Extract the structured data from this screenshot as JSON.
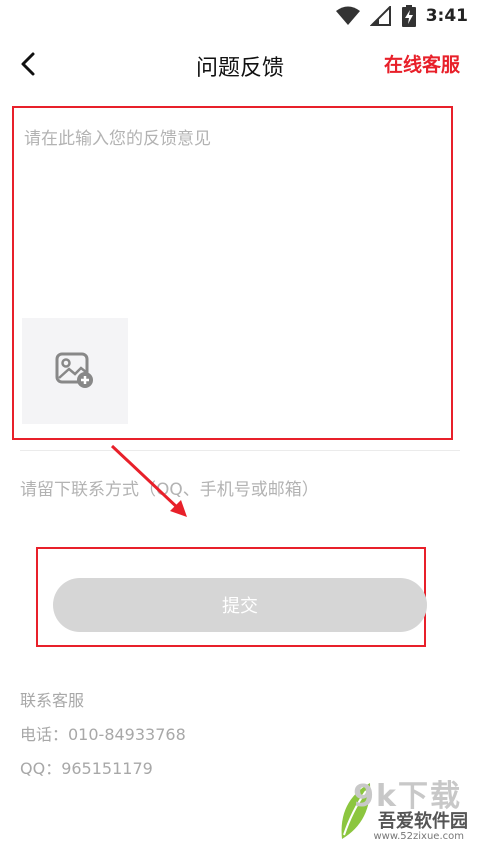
{
  "status_bar": {
    "time": "3:41",
    "icons": [
      "wifi-icon",
      "signal-icon",
      "battery-charging-icon"
    ]
  },
  "header": {
    "title": "问题反馈",
    "right_link": "在线客服",
    "back_icon": "chevron-left-icon"
  },
  "feedback": {
    "placeholder": "请在此输入您的反馈意见",
    "value": "",
    "image_icon": "image-add-icon"
  },
  "contact": {
    "placeholder": "请留下联系方式（QQ、手机号或邮箱）",
    "value": ""
  },
  "submit": {
    "label": "提交"
  },
  "info": {
    "heading": "联系客服",
    "phone": "电话：010-84933768",
    "qq": "QQ：965151179"
  },
  "watermark": {
    "big": "9k下载",
    "name": "吾爱软件园",
    "url": "www.52zixue.com"
  },
  "colors": {
    "accent": "#e8202a",
    "placeholder": "#b3b3b3",
    "disabled_button": "#d6d6d6"
  }
}
